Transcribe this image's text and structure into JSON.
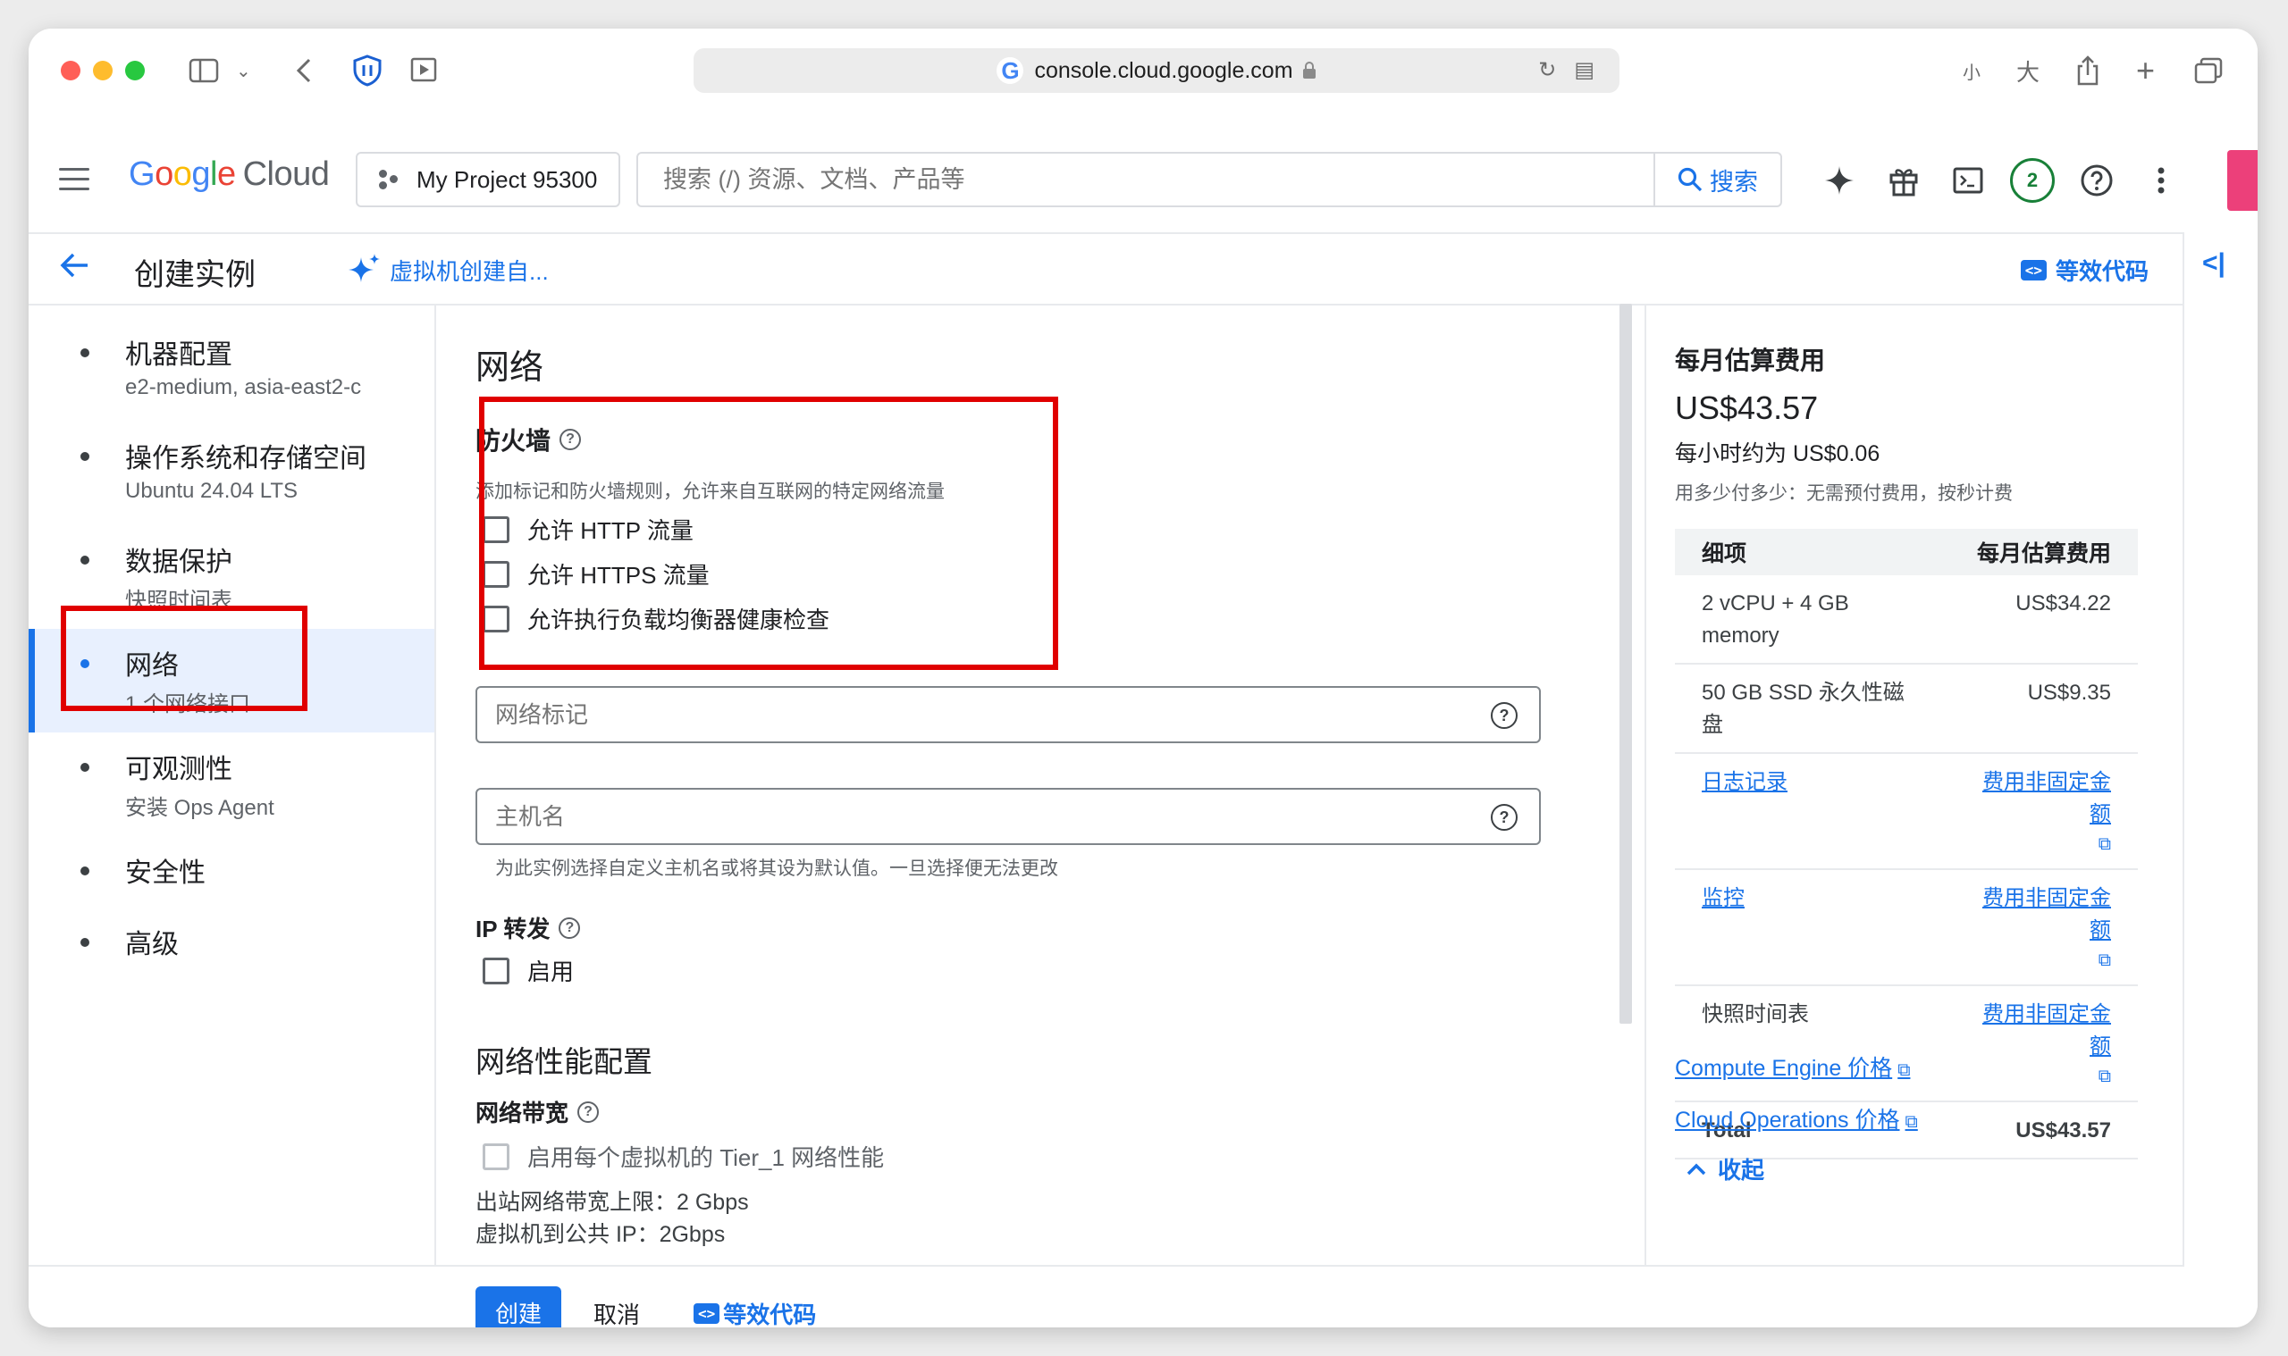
{
  "browser": {
    "url": "console.cloud.google.com",
    "right_icons": [
      "小",
      "大"
    ]
  },
  "header": {
    "logo_google": "Google",
    "logo_cloud": "Cloud",
    "project": "My Project 95300",
    "search_placeholder": "搜索 (/) 资源、文档、产品等",
    "search_button": "搜索",
    "notifications_count": "2"
  },
  "titlebar": {
    "title": "创建实例",
    "ai_link": "虚拟机创建自...",
    "code_link": "等效代码"
  },
  "nav": {
    "items": [
      {
        "label": "机器配置",
        "sub": "e2-medium, asia-east2-c"
      },
      {
        "label": "操作系统和存储空间",
        "sub": "Ubuntu 24.04 LTS"
      },
      {
        "label": "数据保护",
        "sub": "快照时间表"
      },
      {
        "label": "网络",
        "sub": "1 个网络接口"
      },
      {
        "label": "可观测性",
        "sub": "安装 Ops Agent"
      },
      {
        "label": "安全性",
        "sub": ""
      },
      {
        "label": "高级",
        "sub": ""
      }
    ]
  },
  "main": {
    "section_title": "网络",
    "firewall": {
      "title": "防火墙",
      "desc": "添加标记和防火墙规则，允许来自互联网的特定网络流量",
      "options": [
        "允许 HTTP 流量",
        "允许 HTTPS 流量",
        "允许执行负载均衡器健康检查"
      ]
    },
    "network_tags_placeholder": "网络标记",
    "hostname_placeholder": "主机名",
    "hostname_hint": "为此实例选择自定义主机名或将其设为默认值。一旦选择便无法更改",
    "ip_forward": {
      "title": "IP 转发",
      "option": "启用"
    },
    "perf": {
      "title": "网络性能配置",
      "bandwidth_title": "网络带宽",
      "tier1_option": "启用每个虚拟机的 Tier_1 网络性能",
      "egress": "出站网络带宽上限：2 Gbps",
      "public_ip": "虚拟机到公共 IP：2Gbps"
    }
  },
  "footer": {
    "create": "创建",
    "cancel": "取消",
    "code": "等效代码"
  },
  "cost": {
    "title": "每月估算费用",
    "total": "US$43.57",
    "hourly": "每小时约为 US$0.06",
    "note": "用多少付多少：无需预付费用，按秒计费",
    "col_item": "细项",
    "col_cost": "每月估算费用",
    "rows": [
      {
        "item": "2 vCPU + 4 GB memory",
        "cost": "US$34.22"
      },
      {
        "item": "50 GB SSD 永久性磁盘",
        "cost": "US$9.35"
      },
      {
        "item": "日志记录",
        "cost": "费用非固定金额"
      },
      {
        "item": "监控",
        "cost": "费用非固定金额"
      },
      {
        "item": "快照时间表",
        "cost": "费用非固定金额"
      },
      {
        "item": "Total",
        "cost": "US$43.57"
      }
    ],
    "link_compute": "Compute Engine 价格",
    "link_ops": "Cloud Operations 价格",
    "collapse": "收起"
  },
  "colors": {
    "accent": "#1a73e8",
    "highlight_box": "#e00000",
    "active_nav_bg": "#e8f0fe"
  }
}
